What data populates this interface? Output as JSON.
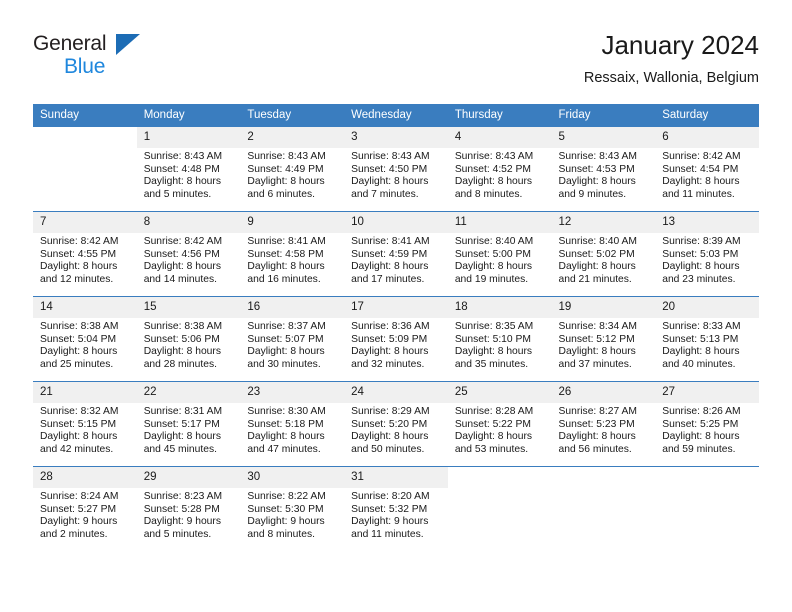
{
  "brand": {
    "name_part1": "General",
    "name_part2": "Blue",
    "flag_icon": "brand-flag-icon",
    "accent_dark_blue": "#1c6cb5",
    "accent_light_blue": "#1f87dd"
  },
  "header": {
    "title": "January 2024",
    "subtitle": "Ressaix, Wallonia, Belgium"
  },
  "theme": {
    "header_row_bg": "#3a7dbf",
    "daynum_bg": "#f0f0f0",
    "grid_line": "#3a7dbf",
    "text": "#1a1a1a"
  },
  "weekdays": [
    "Sunday",
    "Monday",
    "Tuesday",
    "Wednesday",
    "Thursday",
    "Friday",
    "Saturday"
  ],
  "weeks": [
    [
      {
        "day": "",
        "sunrise": "",
        "sunset": "",
        "daylight1": "",
        "daylight2": "",
        "empty": true
      },
      {
        "day": "1",
        "sunrise": "Sunrise: 8:43 AM",
        "sunset": "Sunset: 4:48 PM",
        "daylight1": "Daylight: 8 hours",
        "daylight2": "and 5 minutes."
      },
      {
        "day": "2",
        "sunrise": "Sunrise: 8:43 AM",
        "sunset": "Sunset: 4:49 PM",
        "daylight1": "Daylight: 8 hours",
        "daylight2": "and 6 minutes."
      },
      {
        "day": "3",
        "sunrise": "Sunrise: 8:43 AM",
        "sunset": "Sunset: 4:50 PM",
        "daylight1": "Daylight: 8 hours",
        "daylight2": "and 7 minutes."
      },
      {
        "day": "4",
        "sunrise": "Sunrise: 8:43 AM",
        "sunset": "Sunset: 4:52 PM",
        "daylight1": "Daylight: 8 hours",
        "daylight2": "and 8 minutes."
      },
      {
        "day": "5",
        "sunrise": "Sunrise: 8:43 AM",
        "sunset": "Sunset: 4:53 PM",
        "daylight1": "Daylight: 8 hours",
        "daylight2": "and 9 minutes."
      },
      {
        "day": "6",
        "sunrise": "Sunrise: 8:42 AM",
        "sunset": "Sunset: 4:54 PM",
        "daylight1": "Daylight: 8 hours",
        "daylight2": "and 11 minutes."
      }
    ],
    [
      {
        "day": "7",
        "sunrise": "Sunrise: 8:42 AM",
        "sunset": "Sunset: 4:55 PM",
        "daylight1": "Daylight: 8 hours",
        "daylight2": "and 12 minutes."
      },
      {
        "day": "8",
        "sunrise": "Sunrise: 8:42 AM",
        "sunset": "Sunset: 4:56 PM",
        "daylight1": "Daylight: 8 hours",
        "daylight2": "and 14 minutes."
      },
      {
        "day": "9",
        "sunrise": "Sunrise: 8:41 AM",
        "sunset": "Sunset: 4:58 PM",
        "daylight1": "Daylight: 8 hours",
        "daylight2": "and 16 minutes."
      },
      {
        "day": "10",
        "sunrise": "Sunrise: 8:41 AM",
        "sunset": "Sunset: 4:59 PM",
        "daylight1": "Daylight: 8 hours",
        "daylight2": "and 17 minutes."
      },
      {
        "day": "11",
        "sunrise": "Sunrise: 8:40 AM",
        "sunset": "Sunset: 5:00 PM",
        "daylight1": "Daylight: 8 hours",
        "daylight2": "and 19 minutes."
      },
      {
        "day": "12",
        "sunrise": "Sunrise: 8:40 AM",
        "sunset": "Sunset: 5:02 PM",
        "daylight1": "Daylight: 8 hours",
        "daylight2": "and 21 minutes."
      },
      {
        "day": "13",
        "sunrise": "Sunrise: 8:39 AM",
        "sunset": "Sunset: 5:03 PM",
        "daylight1": "Daylight: 8 hours",
        "daylight2": "and 23 minutes."
      }
    ],
    [
      {
        "day": "14",
        "sunrise": "Sunrise: 8:38 AM",
        "sunset": "Sunset: 5:04 PM",
        "daylight1": "Daylight: 8 hours",
        "daylight2": "and 25 minutes."
      },
      {
        "day": "15",
        "sunrise": "Sunrise: 8:38 AM",
        "sunset": "Sunset: 5:06 PM",
        "daylight1": "Daylight: 8 hours",
        "daylight2": "and 28 minutes."
      },
      {
        "day": "16",
        "sunrise": "Sunrise: 8:37 AM",
        "sunset": "Sunset: 5:07 PM",
        "daylight1": "Daylight: 8 hours",
        "daylight2": "and 30 minutes."
      },
      {
        "day": "17",
        "sunrise": "Sunrise: 8:36 AM",
        "sunset": "Sunset: 5:09 PM",
        "daylight1": "Daylight: 8 hours",
        "daylight2": "and 32 minutes."
      },
      {
        "day": "18",
        "sunrise": "Sunrise: 8:35 AM",
        "sunset": "Sunset: 5:10 PM",
        "daylight1": "Daylight: 8 hours",
        "daylight2": "and 35 minutes."
      },
      {
        "day": "19",
        "sunrise": "Sunrise: 8:34 AM",
        "sunset": "Sunset: 5:12 PM",
        "daylight1": "Daylight: 8 hours",
        "daylight2": "and 37 minutes."
      },
      {
        "day": "20",
        "sunrise": "Sunrise: 8:33 AM",
        "sunset": "Sunset: 5:13 PM",
        "daylight1": "Daylight: 8 hours",
        "daylight2": "and 40 minutes."
      }
    ],
    [
      {
        "day": "21",
        "sunrise": "Sunrise: 8:32 AM",
        "sunset": "Sunset: 5:15 PM",
        "daylight1": "Daylight: 8 hours",
        "daylight2": "and 42 minutes."
      },
      {
        "day": "22",
        "sunrise": "Sunrise: 8:31 AM",
        "sunset": "Sunset: 5:17 PM",
        "daylight1": "Daylight: 8 hours",
        "daylight2": "and 45 minutes."
      },
      {
        "day": "23",
        "sunrise": "Sunrise: 8:30 AM",
        "sunset": "Sunset: 5:18 PM",
        "daylight1": "Daylight: 8 hours",
        "daylight2": "and 47 minutes."
      },
      {
        "day": "24",
        "sunrise": "Sunrise: 8:29 AM",
        "sunset": "Sunset: 5:20 PM",
        "daylight1": "Daylight: 8 hours",
        "daylight2": "and 50 minutes."
      },
      {
        "day": "25",
        "sunrise": "Sunrise: 8:28 AM",
        "sunset": "Sunset: 5:22 PM",
        "daylight1": "Daylight: 8 hours",
        "daylight2": "and 53 minutes."
      },
      {
        "day": "26",
        "sunrise": "Sunrise: 8:27 AM",
        "sunset": "Sunset: 5:23 PM",
        "daylight1": "Daylight: 8 hours",
        "daylight2": "and 56 minutes."
      },
      {
        "day": "27",
        "sunrise": "Sunrise: 8:26 AM",
        "sunset": "Sunset: 5:25 PM",
        "daylight1": "Daylight: 8 hours",
        "daylight2": "and 59 minutes."
      }
    ],
    [
      {
        "day": "28",
        "sunrise": "Sunrise: 8:24 AM",
        "sunset": "Sunset: 5:27 PM",
        "daylight1": "Daylight: 9 hours",
        "daylight2": "and 2 minutes."
      },
      {
        "day": "29",
        "sunrise": "Sunrise: 8:23 AM",
        "sunset": "Sunset: 5:28 PM",
        "daylight1": "Daylight: 9 hours",
        "daylight2": "and 5 minutes."
      },
      {
        "day": "30",
        "sunrise": "Sunrise: 8:22 AM",
        "sunset": "Sunset: 5:30 PM",
        "daylight1": "Daylight: 9 hours",
        "daylight2": "and 8 minutes."
      },
      {
        "day": "31",
        "sunrise": "Sunrise: 8:20 AM",
        "sunset": "Sunset: 5:32 PM",
        "daylight1": "Daylight: 9 hours",
        "daylight2": "and 11 minutes."
      },
      {
        "day": "",
        "sunrise": "",
        "sunset": "",
        "daylight1": "",
        "daylight2": "",
        "empty": true
      },
      {
        "day": "",
        "sunrise": "",
        "sunset": "",
        "daylight1": "",
        "daylight2": "",
        "empty": true
      },
      {
        "day": "",
        "sunrise": "",
        "sunset": "",
        "daylight1": "",
        "daylight2": "",
        "empty": true
      }
    ]
  ]
}
